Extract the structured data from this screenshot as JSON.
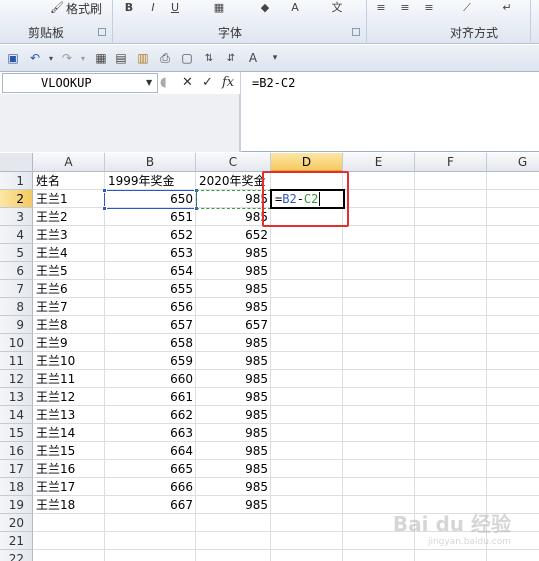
{
  "ribbon": {
    "format_painter_label": "格式刷",
    "groups": [
      "剪贴板",
      "字体",
      "对齐方式"
    ]
  },
  "qat": {
    "icons": [
      "save-icon",
      "undo-icon",
      "redo-icon",
      "borders-icon",
      "format-icon",
      "paste-icon",
      "print-icon",
      "preview-icon",
      "sort-icon",
      "font-size-icon",
      "customize-icon"
    ]
  },
  "formula_bar": {
    "name_box": "VLOOKUP",
    "cancel_glyph": "✕",
    "enter_glyph": "✓",
    "fx_glyph": "fx",
    "formula": "=B2-C2"
  },
  "sheet": {
    "columns": [
      "A",
      "B",
      "C",
      "D",
      "E",
      "F",
      "G"
    ],
    "active_column": "D",
    "active_row": 2,
    "row_numbers": [
      1,
      2,
      3,
      4,
      5,
      6,
      7,
      8,
      9,
      10,
      11,
      12,
      13,
      14,
      15,
      16,
      17,
      18,
      19,
      20,
      21,
      22
    ],
    "header_row": [
      "姓名",
      "1999年奖金",
      "2020年奖金"
    ],
    "rows": [
      [
        "王兰1",
        "650",
        "985"
      ],
      [
        "王兰2",
        "651",
        "985"
      ],
      [
        "王兰3",
        "652",
        "652"
      ],
      [
        "王兰4",
        "653",
        "985"
      ],
      [
        "王兰5",
        "654",
        "985"
      ],
      [
        "王兰6",
        "655",
        "985"
      ],
      [
        "王兰7",
        "656",
        "985"
      ],
      [
        "王兰8",
        "657",
        "657"
      ],
      [
        "王兰9",
        "658",
        "985"
      ],
      [
        "王兰10",
        "659",
        "985"
      ],
      [
        "王兰11",
        "660",
        "985"
      ],
      [
        "王兰12",
        "661",
        "985"
      ],
      [
        "王兰13",
        "662",
        "985"
      ],
      [
        "王兰14",
        "663",
        "985"
      ],
      [
        "王兰15",
        "664",
        "985"
      ],
      [
        "王兰16",
        "665",
        "985"
      ],
      [
        "王兰17",
        "666",
        "985"
      ],
      [
        "王兰18",
        "667",
        "985"
      ]
    ],
    "editing_cell_formula_part1": "=",
    "editing_cell_formula_part2": "B2",
    "editing_cell_formula_part3": "-",
    "editing_cell_formula_part4": "C2"
  },
  "colors": {
    "ref_b2": "#2f55c8",
    "ref_c2": "#3a9a3a",
    "highlight_box": "#e03030"
  },
  "watermark": {
    "brand": "Bai du 经验",
    "sub": "jingyan.baidu.com"
  }
}
